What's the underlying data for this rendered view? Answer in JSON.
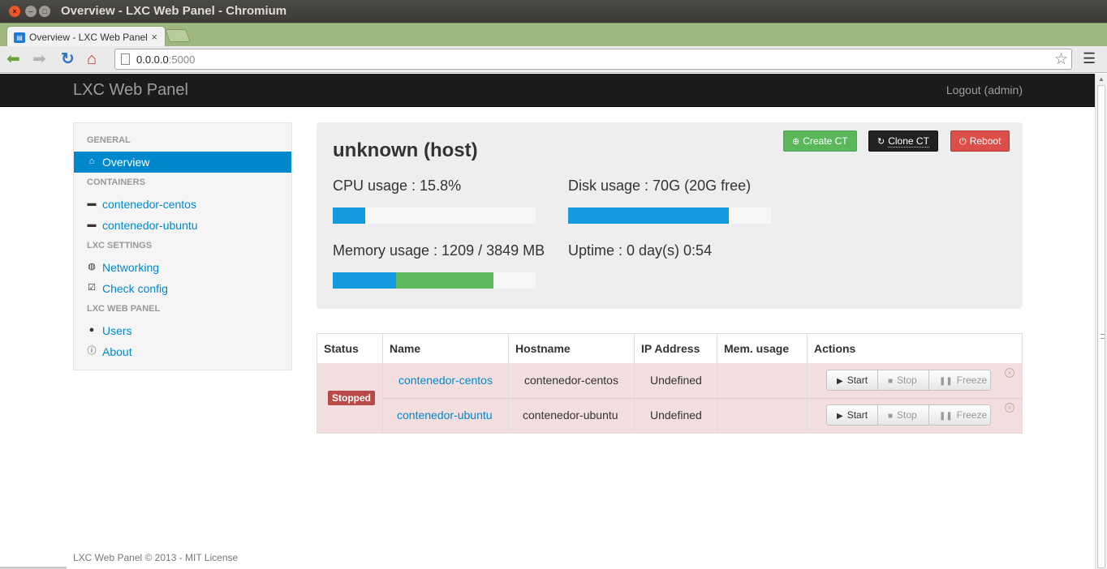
{
  "window": {
    "title": "Overview - LXC Web Panel - Chromium"
  },
  "browser": {
    "tab_title": "Overview - LXC Web Panel",
    "url_host": "0.0.0.0",
    "url_port": ":5000"
  },
  "navbar": {
    "brand": "LXC Web Panel",
    "logout": "Logout (admin)"
  },
  "sidebar": {
    "general_header": "GENERAL",
    "overview": "Overview",
    "containers_header": "CONTAINERS",
    "containers": [
      "contenedor-centos",
      "contenedor-ubuntu"
    ],
    "lxc_settings_header": "LXC SETTINGS",
    "networking": "Networking",
    "check_config": "Check config",
    "lxc_web_panel_header": "LXC WEB PANEL",
    "users": "Users",
    "about": "About"
  },
  "host": {
    "title": "unknown (host)",
    "buttons": {
      "create": "Create CT",
      "clone": "Clone CT",
      "reboot": "Reboot"
    },
    "cpu_label": "CPU usage : 15.8%",
    "cpu_percent": 15.8,
    "disk_label": "Disk usage : 70G (20G free)",
    "disk_fraction": 0.79,
    "memory_label": "Memory usage : 1209 / 3849 MB",
    "memory_used_fraction": 0.31,
    "memory_cached_fraction": 0.48,
    "uptime_label": "Uptime : 0 day(s) 0:54"
  },
  "table": {
    "headers": [
      "Status",
      "Name",
      "Hostname",
      "IP Address",
      "Mem. usage",
      "Actions"
    ],
    "status_badge": "Stopped",
    "rows": [
      {
        "name": "contenedor-centos",
        "hostname": "contenedor-centos",
        "ip": "Undefined",
        "mem": ""
      },
      {
        "name": "contenedor-ubuntu",
        "hostname": "contenedor-ubuntu",
        "ip": "Undefined",
        "mem": ""
      }
    ],
    "actions": {
      "start": "Start",
      "stop": "Stop",
      "freeze": "Freeze"
    }
  },
  "footer": "LXC Web Panel © 2013 - MIT License",
  "colors": {
    "primary": "#0088cc",
    "success": "#5bb75b",
    "danger": "#da4f49",
    "row_error": "#f2dede",
    "progress_blue": "#149bdf"
  }
}
